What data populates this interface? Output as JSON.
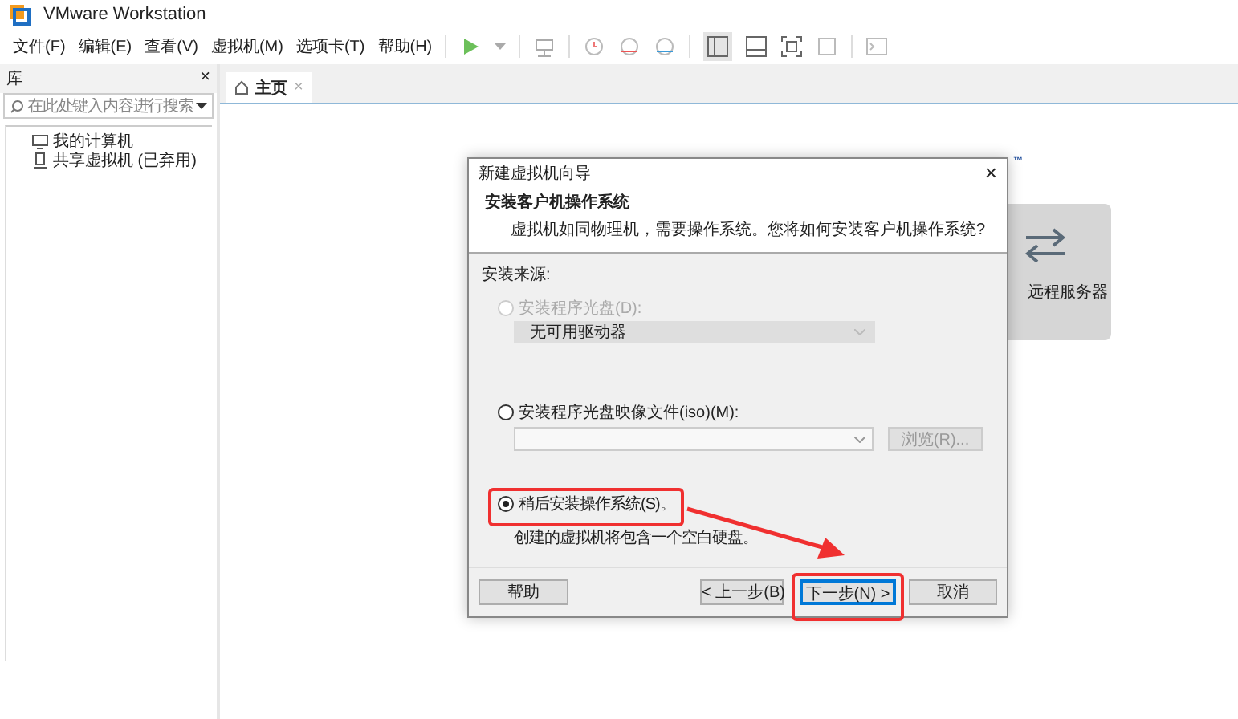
{
  "window": {
    "title": "VMware Workstation"
  },
  "menu": [
    "文件(F)",
    "编辑(E)",
    "查看(V)",
    "虚拟机(M)",
    "选项卡(T)",
    "帮助(H)"
  ],
  "library": {
    "title": "库",
    "close": "×",
    "search": {
      "placeholder": "在此处键入内容进行搜索"
    },
    "items": [
      {
        "label": "我的计算机",
        "kind": "computer"
      },
      {
        "label": "共享虚拟机 (已弃用)",
        "kind": "shared"
      }
    ]
  },
  "tabs": [
    {
      "label": "主页",
      "selected": true,
      "close": "×"
    }
  ],
  "home": {
    "trademark": "™",
    "card": {
      "label": "远程服务器"
    }
  },
  "dialog": {
    "title": "新建虚拟机向导",
    "close": "×",
    "heading": "安装客户机操作系统",
    "subheading": "虚拟机如同物理机，需要操作系统。您将如何安装客户机操作系统?",
    "source_label": "安装来源:",
    "options": [
      {
        "label": "安装程序光盘(D):",
        "selected": false,
        "disabled": true,
        "control": {
          "kind": "dropdown",
          "value": "无可用驱动器"
        }
      },
      {
        "label": "安装程序光盘映像文件(iso)(M):",
        "selected": false,
        "disabled": false,
        "control": {
          "kind": "combo",
          "button": "浏览(R)..."
        }
      },
      {
        "label": "稍后安装操作系统(S)。",
        "selected": true,
        "disabled": false,
        "note": "创建的虚拟机将包含一个空白硬盘。"
      }
    ],
    "buttons": [
      {
        "label": "帮助",
        "kind": "help"
      },
      {
        "label": "< 上一步(B)",
        "kind": "back"
      },
      {
        "label": "下一步(N) >",
        "kind": "next",
        "focused": true
      },
      {
        "label": "取消",
        "kind": "cancel"
      }
    ]
  }
}
